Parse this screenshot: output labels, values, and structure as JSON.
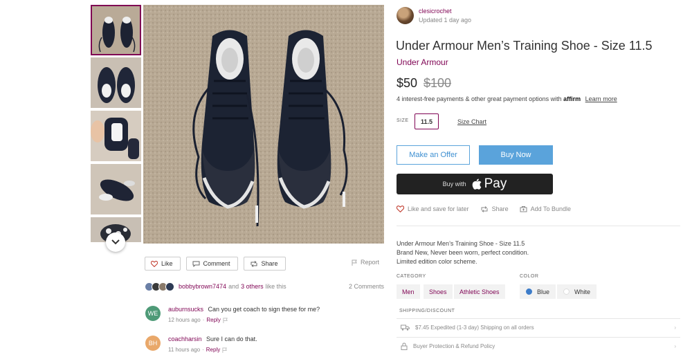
{
  "seller": {
    "name": "clesicrochet",
    "updated": "Updated 1 day ago"
  },
  "listing": {
    "title": "Under Armour Men’s Training Shoe - Size 11.5",
    "brand": "Under Armour",
    "price": "$50",
    "original_price": "$100",
    "affirm_text": "4 interest-free payments & other great payment options with",
    "affirm_logo": "affirm",
    "affirm_link": "Learn more",
    "size_label": "SIZE",
    "size": "11.5",
    "size_chart": "Size Chart",
    "offer_button": "Make an Offer",
    "buy_button": "Buy Now",
    "apple_pay_prefix": "Buy with",
    "apple_pay_label": "Pay",
    "like_save": "Like and save for later",
    "share": "Share",
    "bundle": "Add To Bundle",
    "description": [
      "Under Armour Men’s Training Shoe - Size 11.5",
      "Brand New, Never been worn, perfect condition.",
      "Limited edition color scheme."
    ],
    "category_label": "CATEGORY",
    "categories": [
      "Men",
      "Shoes",
      "Athletic Shoes"
    ],
    "color_label": "COLOR",
    "colors": [
      {
        "name": "Blue",
        "hex": "#3d7cc9"
      },
      {
        "name": "White",
        "hex": "#ffffff"
      }
    ],
    "shipping_label": "SHIPPING/DISCOUNT",
    "shipping_rows": [
      "$7.45 Expedited (1-3 day) Shipping on all orders",
      "Buyer Protection & Refund Policy"
    ]
  },
  "social": {
    "like": "Like",
    "comment": "Comment",
    "share": "Share",
    "report": "Report",
    "liked_by_user": "bobbybrown7474",
    "and_text": "and",
    "others": "3 others",
    "like_this": "like this",
    "comment_count": "2 Comments"
  },
  "comments": [
    {
      "initials": "WE",
      "avatar_color": "#4e9a77",
      "user": "auburnsucks",
      "text": "Can you get coach to sign these for me?",
      "time": "12 hours ago",
      "reply": "Reply"
    },
    {
      "initials": "BH",
      "avatar_color": "#e9a86a",
      "user": "coachharsin",
      "text": "Sure I can do that.",
      "time": "11 hours ago",
      "reply": "Reply"
    }
  ],
  "colors": {
    "accent": "#7f0353",
    "button_blue": "#5aa3db"
  }
}
